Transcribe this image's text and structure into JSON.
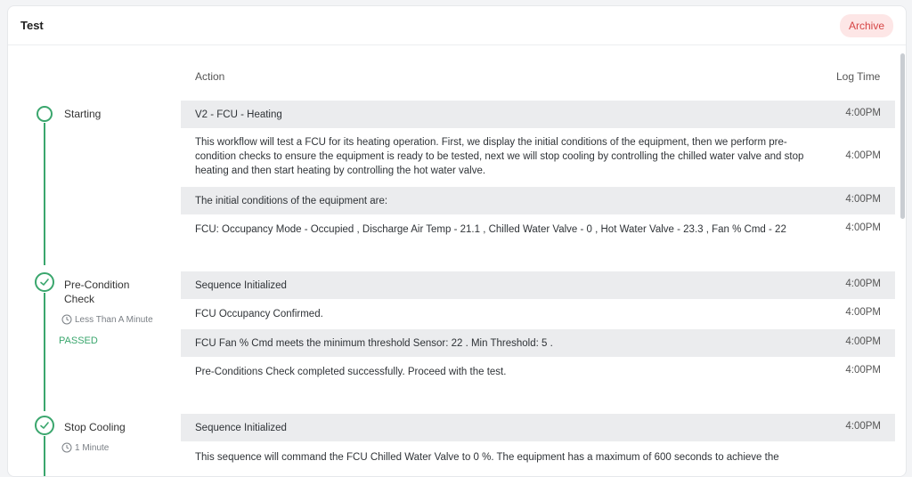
{
  "card": {
    "title": "Test",
    "archive_label": "Archive"
  },
  "columns": {
    "action": "Action",
    "log_time": "Log Time"
  },
  "steps": [
    {
      "label": "Starting",
      "state": "in-progress"
    },
    {
      "label": "Pre-Condition Check",
      "state": "done",
      "duration": "Less Than A Minute",
      "status": "PASSED"
    },
    {
      "label": "Stop Cooling",
      "state": "done",
      "duration": "1 Minute"
    }
  ],
  "rows": [
    {
      "text": "V2 - FCU - Heating",
      "time": "4:00PM"
    },
    {
      "text": "This workflow will test a FCU for its heating operation. First, we display the initial conditions of the equipment, then we perform pre-condition checks to ensure the equipment is ready to be tested, next we will stop cooling by controlling the chilled water valve and stop heating and then start heating by controlling the hot water valve.",
      "time": "4:00PM"
    },
    {
      "text": "The initial conditions of the equipment are:",
      "time": "4:00PM"
    },
    {
      "text": "FCU: Occupancy Mode - Occupied , Discharge Air Temp - 21.1 , Chilled Water Valve - 0 , Hot Water Valve - 23.3 , Fan % Cmd - 22",
      "time": "4:00PM"
    },
    {
      "text": "Sequence Initialized",
      "time": "4:00PM"
    },
    {
      "text": "FCU Occupancy Confirmed.",
      "time": "4:00PM"
    },
    {
      "text": "FCU Fan % Cmd meets the minimum threshold Sensor: 22 . Min Threshold: 5 .",
      "time": "4:00PM"
    },
    {
      "text": "Pre-Conditions Check completed successfully. Proceed with the test.",
      "time": "4:00PM"
    },
    {
      "text": "Sequence Initialized",
      "time": "4:00PM"
    },
    {
      "text": "This sequence will command the FCU Chilled Water Valve to 0 %. The equipment has a maximum of 600 seconds to achieve the",
      "time": ""
    }
  ],
  "colors": {
    "accent_green": "#3aa66d",
    "archive_text": "#d64545",
    "archive_bg": "#fde6e6",
    "row_shade": "#ebecee"
  }
}
